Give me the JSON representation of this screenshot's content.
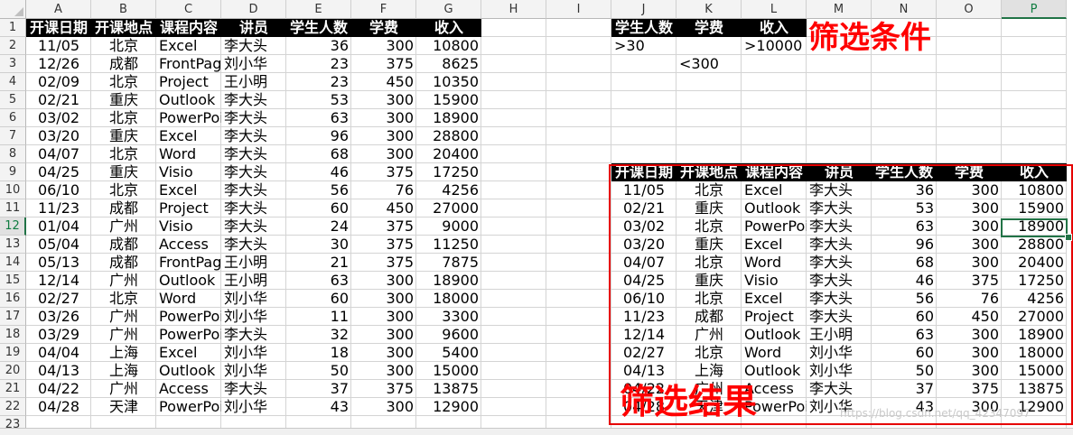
{
  "spreadsheet": {
    "columns": [
      "A",
      "B",
      "C",
      "D",
      "E",
      "F",
      "G",
      "H",
      "I",
      "J",
      "K",
      "L",
      "M",
      "N",
      "O",
      "P"
    ],
    "selected_column": "P",
    "selected_row": "12",
    "row_numbers": [
      "1",
      "2",
      "3",
      "4",
      "5",
      "6",
      "7",
      "8",
      "9",
      "10",
      "11",
      "12",
      "13",
      "14",
      "15",
      "16",
      "17",
      "18",
      "19",
      "20",
      "21",
      "22",
      "23"
    ],
    "headers": [
      "开课日期",
      "开课地点",
      "课程内容",
      "讲员",
      "学生人数",
      "学费",
      "收入"
    ],
    "rows": [
      [
        "11/05",
        "北京",
        "Excel",
        "李大头",
        "36",
        "300",
        "10800"
      ],
      [
        "12/26",
        "成都",
        "FrontPage",
        "刘小华",
        "23",
        "375",
        "8625"
      ],
      [
        "02/09",
        "北京",
        "Project",
        "王小明",
        "23",
        "450",
        "10350"
      ],
      [
        "02/21",
        "重庆",
        "Outlook",
        "李大头",
        "53",
        "300",
        "15900"
      ],
      [
        "03/02",
        "北京",
        "PowerPoint",
        "李大头",
        "63",
        "300",
        "18900"
      ],
      [
        "03/20",
        "重庆",
        "Excel",
        "李大头",
        "96",
        "300",
        "28800"
      ],
      [
        "04/07",
        "北京",
        "Word",
        "李大头",
        "68",
        "300",
        "20400"
      ],
      [
        "04/25",
        "重庆",
        "Visio",
        "李大头",
        "46",
        "375",
        "17250"
      ],
      [
        "06/10",
        "北京",
        "Excel",
        "李大头",
        "56",
        "76",
        "4256"
      ],
      [
        "11/23",
        "成都",
        "Project",
        "李大头",
        "60",
        "450",
        "27000"
      ],
      [
        "01/04",
        "广州",
        "Visio",
        "李大头",
        "24",
        "375",
        "9000"
      ],
      [
        "05/04",
        "成都",
        "Access",
        "李大头",
        "30",
        "375",
        "11250"
      ],
      [
        "05/13",
        "成都",
        "FrontPage",
        "王小明",
        "21",
        "375",
        "7875"
      ],
      [
        "12/14",
        "广州",
        "Outlook",
        "王小明",
        "63",
        "300",
        "18900"
      ],
      [
        "02/27",
        "北京",
        "Word",
        "刘小华",
        "60",
        "300",
        "18000"
      ],
      [
        "03/26",
        "广州",
        "PowerPoint",
        "刘小华",
        "11",
        "300",
        "3300"
      ],
      [
        "03/29",
        "广州",
        "PowerPoint",
        "李大头",
        "32",
        "300",
        "9600"
      ],
      [
        "04/04",
        "上海",
        "Excel",
        "刘小华",
        "18",
        "300",
        "5400"
      ],
      [
        "04/13",
        "上海",
        "Outlook",
        "刘小华",
        "50",
        "300",
        "15000"
      ],
      [
        "04/22",
        "广州",
        "Access",
        "李大头",
        "37",
        "375",
        "13875"
      ],
      [
        "04/28",
        "天津",
        "PowerPoint",
        "刘小华",
        "43",
        "300",
        "12900"
      ]
    ],
    "criteria": {
      "headers": [
        "学生人数",
        "学费",
        "收入"
      ],
      "row1": [
        ">30",
        "",
        ">10000"
      ],
      "row2": [
        "",
        "<300",
        ""
      ],
      "title": "筛选条件"
    },
    "result": {
      "headers": [
        "开课日期",
        "开课地点",
        "课程内容",
        "讲员",
        "学生人数",
        "学费",
        "收入"
      ],
      "rows": [
        [
          "11/05",
          "北京",
          "Excel",
          "李大头",
          "36",
          "300",
          "10800"
        ],
        [
          "02/21",
          "重庆",
          "Outlook",
          "李大头",
          "53",
          "300",
          "15900"
        ],
        [
          "03/02",
          "北京",
          "PowerPoint",
          "李大头",
          "63",
          "300",
          "18900"
        ],
        [
          "03/20",
          "重庆",
          "Excel",
          "李大头",
          "96",
          "300",
          "28800"
        ],
        [
          "04/07",
          "北京",
          "Word",
          "李大头",
          "68",
          "300",
          "20400"
        ],
        [
          "04/25",
          "重庆",
          "Visio",
          "李大头",
          "46",
          "375",
          "17250"
        ],
        [
          "06/10",
          "北京",
          "Excel",
          "李大头",
          "56",
          "76",
          "4256"
        ],
        [
          "11/23",
          "成都",
          "Project",
          "李大头",
          "60",
          "450",
          "27000"
        ],
        [
          "12/14",
          "广州",
          "Outlook",
          "王小明",
          "63",
          "300",
          "18900"
        ],
        [
          "02/27",
          "北京",
          "Word",
          "刘小华",
          "60",
          "300",
          "18000"
        ],
        [
          "04/13",
          "上海",
          "Outlook",
          "刘小华",
          "50",
          "300",
          "15000"
        ],
        [
          "04/22",
          "广州",
          "Access",
          "李大头",
          "37",
          "375",
          "13875"
        ],
        [
          "04/28",
          "天津",
          "PowerPoint",
          "刘小华",
          "43",
          "300",
          "12900"
        ]
      ],
      "title": "筛选结果"
    },
    "watermark": "https://blog.csdn.net/qq_42347097"
  },
  "colors": {
    "header_bg": "#000000",
    "header_text": "#ffffff",
    "annotation_red": "#ff0000",
    "selection_green": "#217346"
  }
}
